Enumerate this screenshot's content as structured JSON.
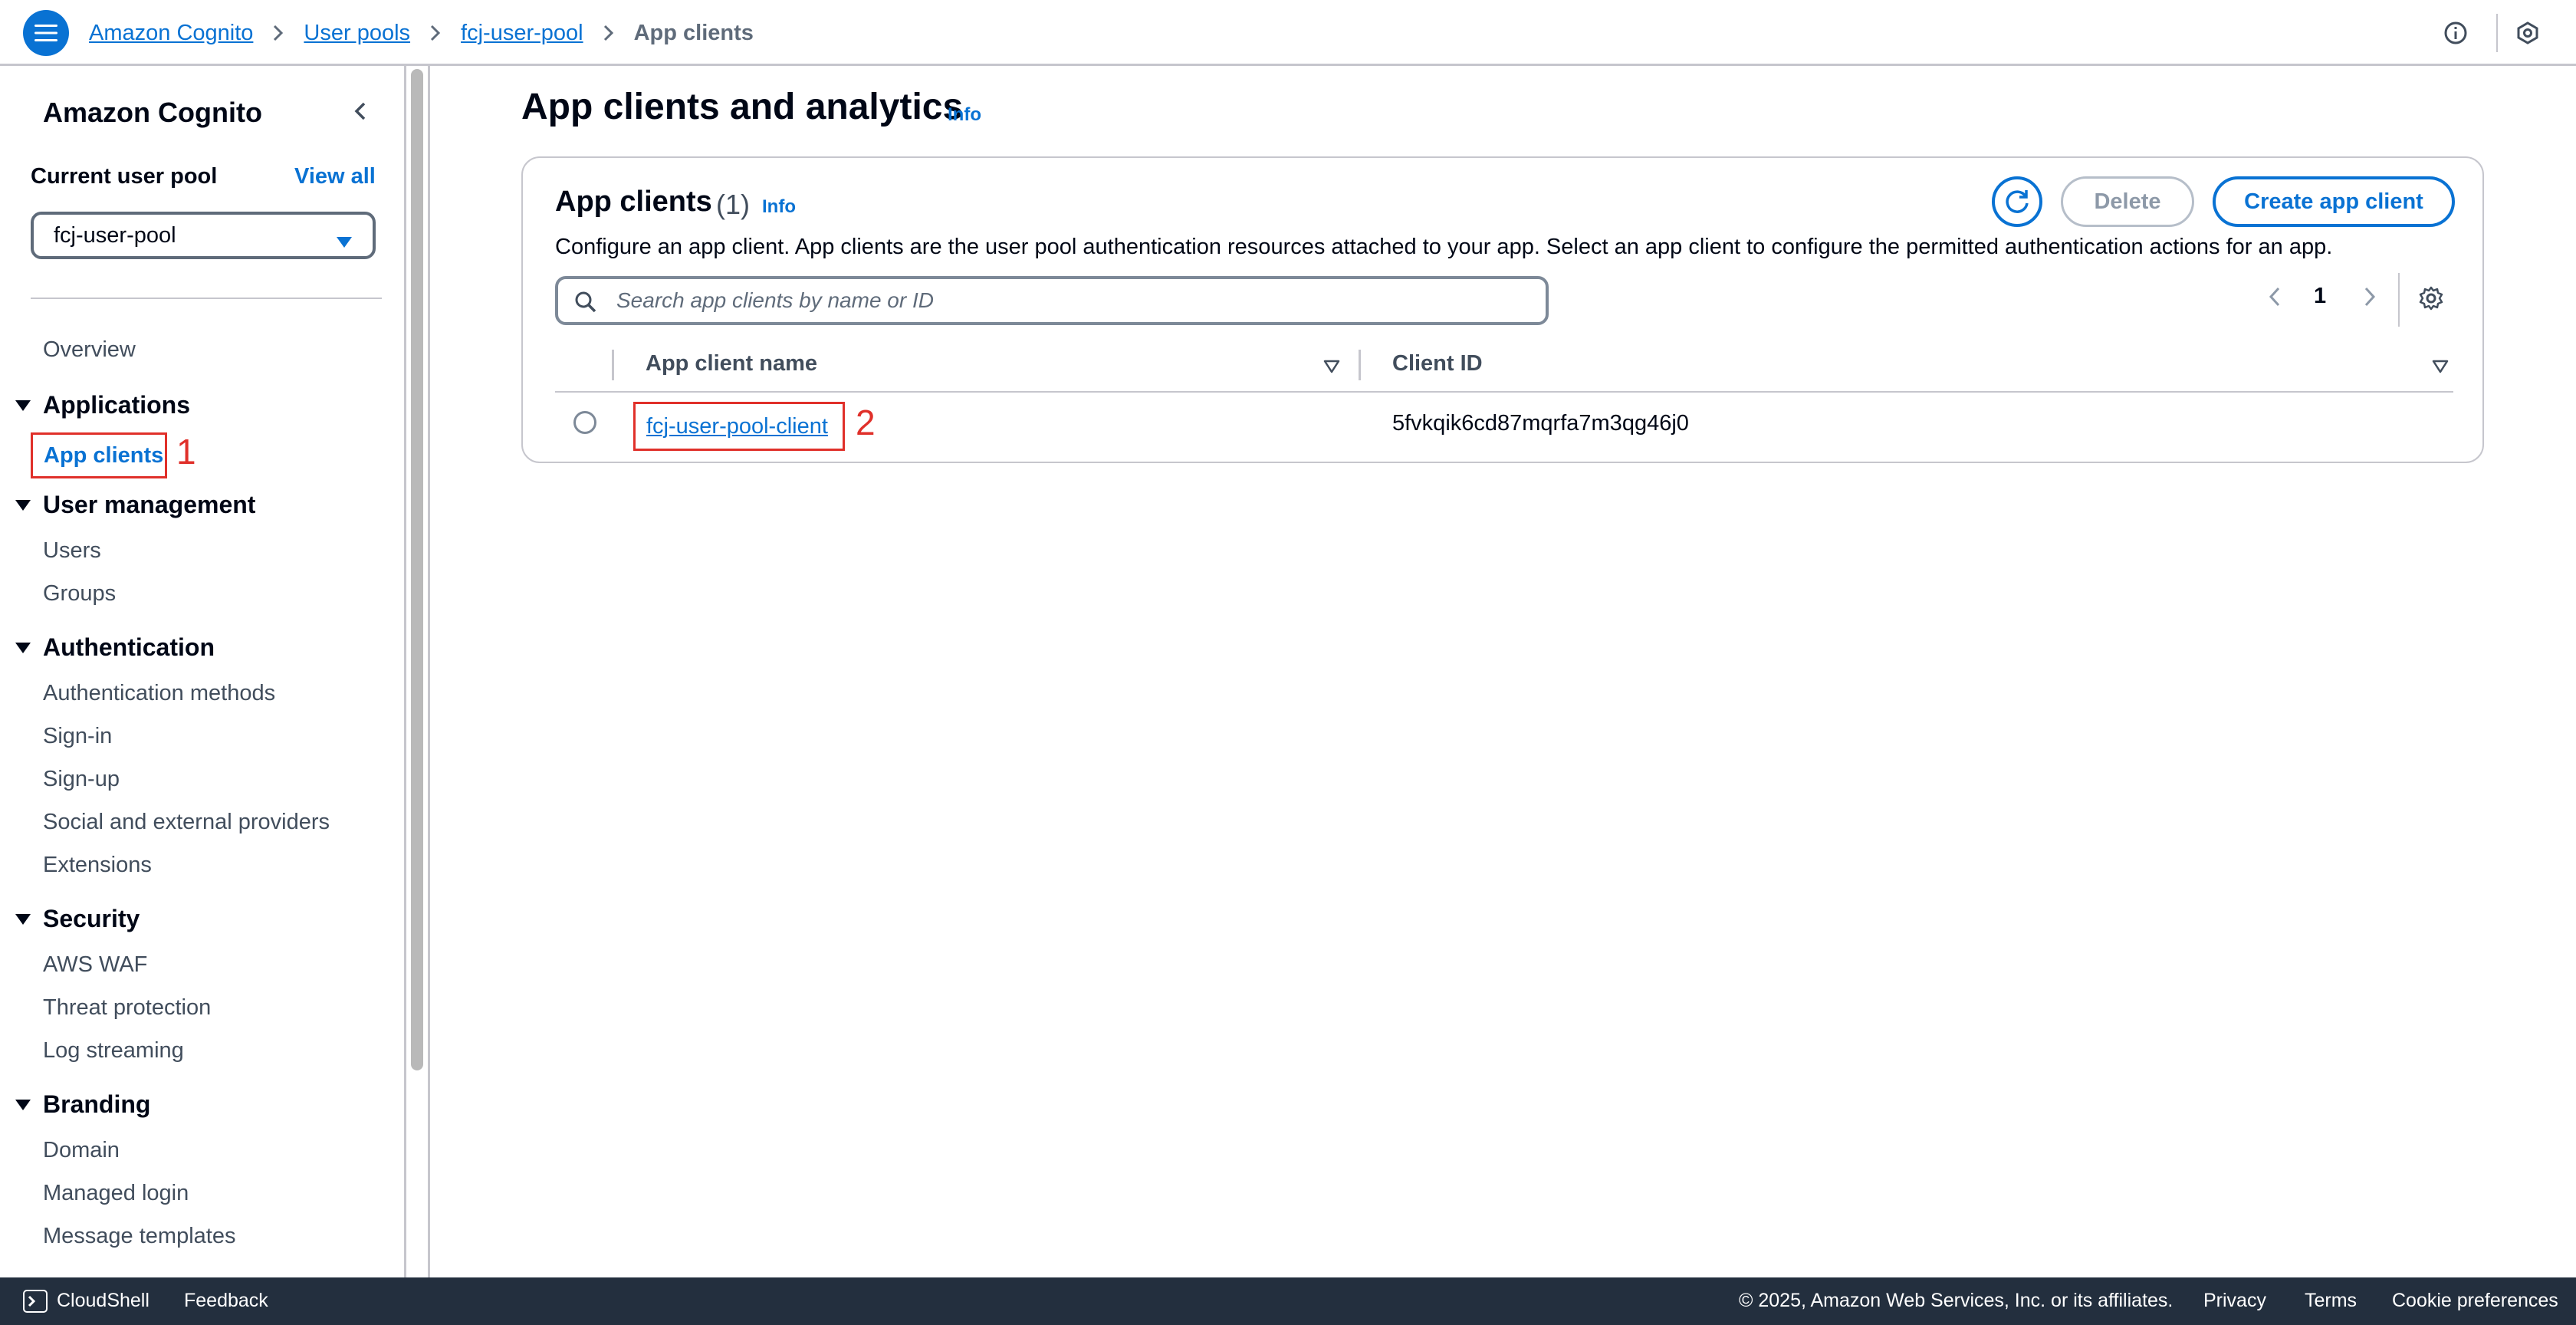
{
  "breadcrumbs": {
    "items": [
      "Amazon Cognito",
      "User pools",
      "fcj-user-pool"
    ],
    "current": "App clients"
  },
  "sidebar": {
    "title": "Amazon Cognito",
    "current_pool_label": "Current user pool",
    "view_all": "View all",
    "selected_pool": "fcj-user-pool",
    "overview": "Overview",
    "sections": [
      {
        "label": "Applications",
        "items": [
          "App clients"
        ]
      },
      {
        "label": "User management",
        "items": [
          "Users",
          "Groups"
        ]
      },
      {
        "label": "Authentication",
        "items": [
          "Authentication methods",
          "Sign-in",
          "Sign-up",
          "Social and external providers",
          "Extensions"
        ]
      },
      {
        "label": "Security",
        "items": [
          "AWS WAF",
          "Threat protection",
          "Log streaming"
        ]
      },
      {
        "label": "Branding",
        "items": [
          "Domain",
          "Managed login",
          "Message templates"
        ]
      }
    ],
    "annotation": "1"
  },
  "main": {
    "title": "App clients and analytics",
    "info": "Info",
    "card": {
      "title": "App clients",
      "count": "(1)",
      "info": "Info",
      "description": "Configure an app client. App clients are the user pool authentication resources attached to your app. Select an app client to configure the permitted authentication actions for an app.",
      "delete_label": "Delete",
      "create_label": "Create app client",
      "search_placeholder": "Search app clients by name or ID",
      "page_number": "1",
      "columns": [
        "App client name",
        "Client ID"
      ],
      "rows": [
        {
          "name": "fcj-user-pool-client",
          "client_id": "5fvkqik6cd87mqrfa7m3qg46j0"
        }
      ],
      "annotation": "2"
    }
  },
  "footer": {
    "cloudshell": "CloudShell",
    "feedback": "Feedback",
    "copyright": "© 2025, Amazon Web Services, Inc. or its affiliates.",
    "privacy": "Privacy",
    "terms": "Terms",
    "cookies": "Cookie preferences"
  },
  "colors": {
    "accent": "#0972d3",
    "annotation": "#e0302a",
    "footer_bg": "#232f3e"
  }
}
